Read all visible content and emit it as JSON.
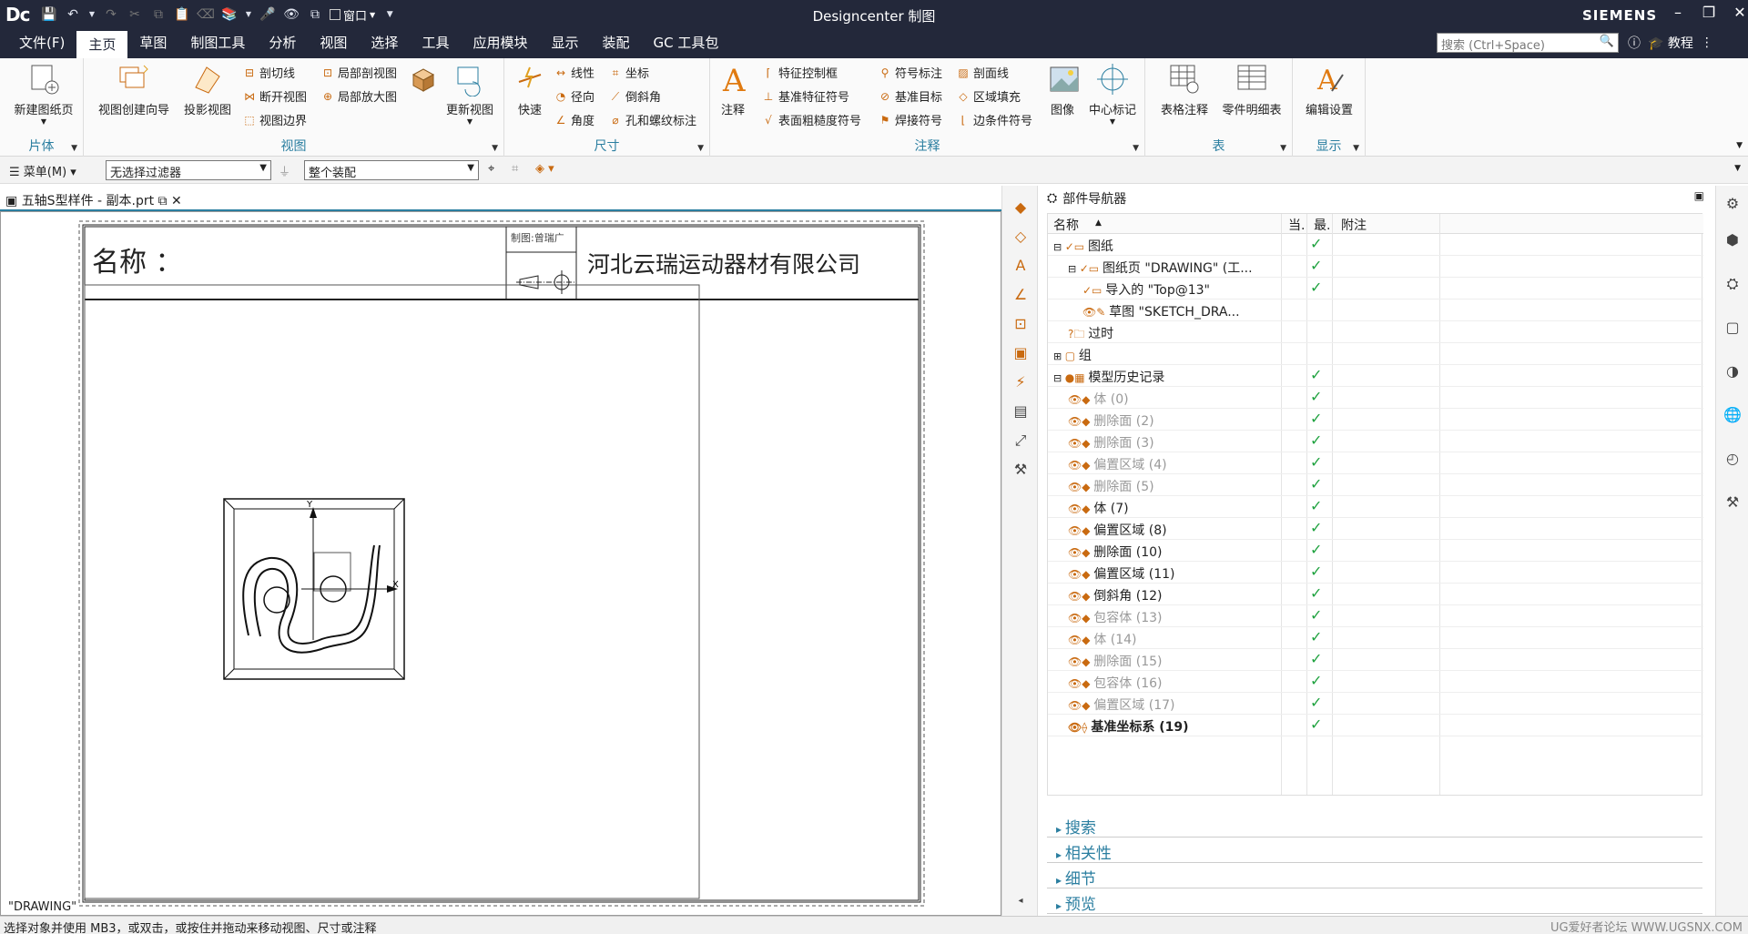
{
  "titlebar": {
    "logo": "Dc",
    "title": "Designcenter 制图",
    "brand": "SIEMENS",
    "window_menu": "窗口"
  },
  "menus": [
    "文件(F)",
    "主页",
    "草图",
    "制图工具",
    "分析",
    "视图",
    "选择",
    "工具",
    "应用模块",
    "显示",
    "装配",
    "GC 工具包"
  ],
  "search": {
    "placeholder": "搜索 (Ctrl+Space)"
  },
  "help": {
    "tutorial": "教程"
  },
  "ribbon": {
    "sheet": {
      "new_sheet": "新建图纸页",
      "label": "片体"
    },
    "view": {
      "wizard": "视图创建向导",
      "projected": "投影视图",
      "section_line": "剖切线",
      "break_view": "断开视图",
      "view_boundary": "视图边界",
      "local_section": "局部剖视图",
      "detail_view": "局部放大图",
      "update_view": "更新视图",
      "label": "视图"
    },
    "dimension": {
      "rapid": "快速",
      "linear": "线性",
      "radial": "径向",
      "angular": "角度",
      "coordinate": "坐标",
      "chamfer": "倒斜角",
      "hole_thread": "孔和螺纹标注",
      "label": "尺寸"
    },
    "annotation": {
      "note": "注释",
      "fcf": "特征控制框",
      "datum_symbol": "基准特征符号",
      "surface_finish": "表面粗糙度符号",
      "id_symbol": "符号标注",
      "datum_target": "基准目标",
      "weld": "焊接符号",
      "hatch": "剖面线",
      "area_fill": "区域填充",
      "edge_condition": "边条件符号",
      "image": "图像",
      "center_mark": "中心标记",
      "label": "注释"
    },
    "table": {
      "tabular_note": "表格注释",
      "parts_list": "零件明细表",
      "label": "表"
    },
    "display": {
      "edit_settings": "编辑设置",
      "label": "显示"
    }
  },
  "toolbar2": {
    "menu": "菜单(M)",
    "filter": "无选择过滤器",
    "scope": "整个装配"
  },
  "document": {
    "tab": "五轴S型样件 - 副本.prt"
  },
  "drawing": {
    "title_label": "名称 ：",
    "company": "河北云瑞运动器材有限公司",
    "drafter": "制图:曾瑞广",
    "sheet_name": "\"DRAWING\"",
    "axis_x": "X",
    "axis_y": "Y"
  },
  "navigator": {
    "title": "部件导航器",
    "columns": [
      "名称",
      "当.",
      "最.",
      "附注"
    ],
    "rows": [
      {
        "name": "图纸",
        "check": "✓"
      },
      {
        "name": "图纸页 \"DRAWING\" (工...",
        "check": "✓"
      },
      {
        "name": "导入的 \"Top@13\"",
        "check": "✓"
      },
      {
        "name": "草图 \"SKETCH_DRA...",
        "check": ""
      },
      {
        "name": "过时",
        "check": ""
      },
      {
        "name": "组",
        "check": ""
      },
      {
        "name": "模型历史记录",
        "check": "✓"
      },
      {
        "name": "体 (0)",
        "check": "✓"
      },
      {
        "name": "删除面 (2)",
        "check": "✓"
      },
      {
        "name": "删除面 (3)",
        "check": "✓"
      },
      {
        "name": "偏置区域 (4)",
        "check": "✓"
      },
      {
        "name": "删除面 (5)",
        "check": "✓"
      },
      {
        "name": "体 (7)",
        "check": "✓"
      },
      {
        "name": "偏置区域 (8)",
        "check": "✓"
      },
      {
        "name": "删除面 (10)",
        "check": "✓"
      },
      {
        "name": "偏置区域 (11)",
        "check": "✓"
      },
      {
        "name": "倒斜角 (12)",
        "check": "✓"
      },
      {
        "name": "包容体 (13)",
        "check": "✓"
      },
      {
        "name": "体 (14)",
        "check": "✓"
      },
      {
        "name": "删除面 (15)",
        "check": "✓"
      },
      {
        "name": "包容体 (16)",
        "check": "✓"
      },
      {
        "name": "偏置区域 (17)",
        "check": "✓"
      },
      {
        "name": "基准坐标系 (19)",
        "check": "✓"
      }
    ],
    "panels": [
      "搜索",
      "相关性",
      "细节",
      "预览"
    ]
  },
  "status": {
    "message": "选择对象并使用 MB3，或双击，或按住并拖动来移动视图、尺寸或注释",
    "watermark": "UG爱好者论坛 WWW.UGSNX.COM"
  }
}
